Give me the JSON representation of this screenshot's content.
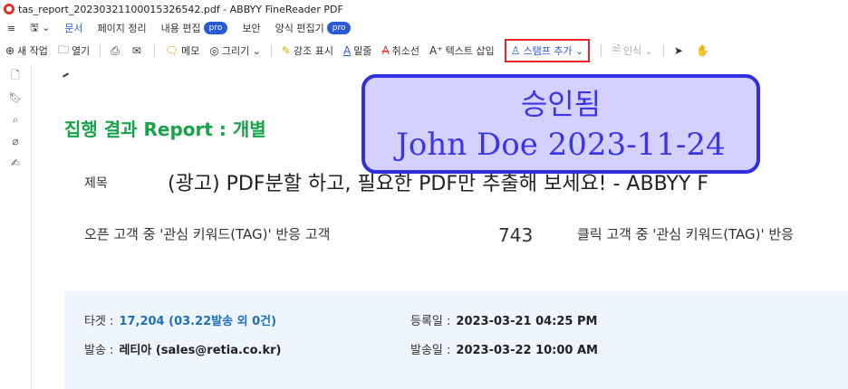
{
  "window": {
    "title": "tas_report_20230321100015326542.pdf - ABBYY FineReader PDF"
  },
  "menubar": {
    "items": [
      {
        "label": "문서"
      },
      {
        "label": "페이지 정리"
      },
      {
        "label": "내용 편집",
        "badge": "pro"
      },
      {
        "label": "보안"
      },
      {
        "label": "양식 편집기",
        "badge": "pro"
      }
    ]
  },
  "toolbar": {
    "new_task": "새 작업",
    "open": "열기",
    "memo": "메모",
    "draw": "그리기",
    "highlight": "강조 표시",
    "underline": "밑줄",
    "strikethrough": "취소선",
    "insert_text": "텍스트 삽입",
    "add_stamp": "스탬프 추가",
    "recognize": "인식"
  },
  "document": {
    "report_title": "집행 결과 Report : 개별",
    "subject_label": "제목",
    "subject_value": "(광고) PDF분할 하고, 필요한 PDF만 추출해 보세요! - ABBYY F",
    "metric1_label": "오픈 고객 중 '관심 키워드(TAG)' 반응 고객",
    "metric1_value": "743",
    "metric2_label": "클릭 고객 중 '관심 키워드(TAG)' 반응",
    "target_label": "타겟 :",
    "target_value": "17,204 (03.22발송 외 0건)",
    "registered_label": "등록일 :",
    "registered_value": "2023-03-21 04:25 PM",
    "sender_label": "발송 :",
    "sender_value": "레티아 (sales@retia.co.kr)",
    "sent_label": "발송일 :",
    "sent_value": "2023-03-22 10:00 AM"
  },
  "stamp": {
    "line1": "승인됨",
    "line2": "John Doe 2023-11-24"
  },
  "colors": {
    "accent": "#2a5bd7",
    "report_title": "#16a34a",
    "stamp": "#3b34e8",
    "highlight_border": "#e8262a"
  }
}
